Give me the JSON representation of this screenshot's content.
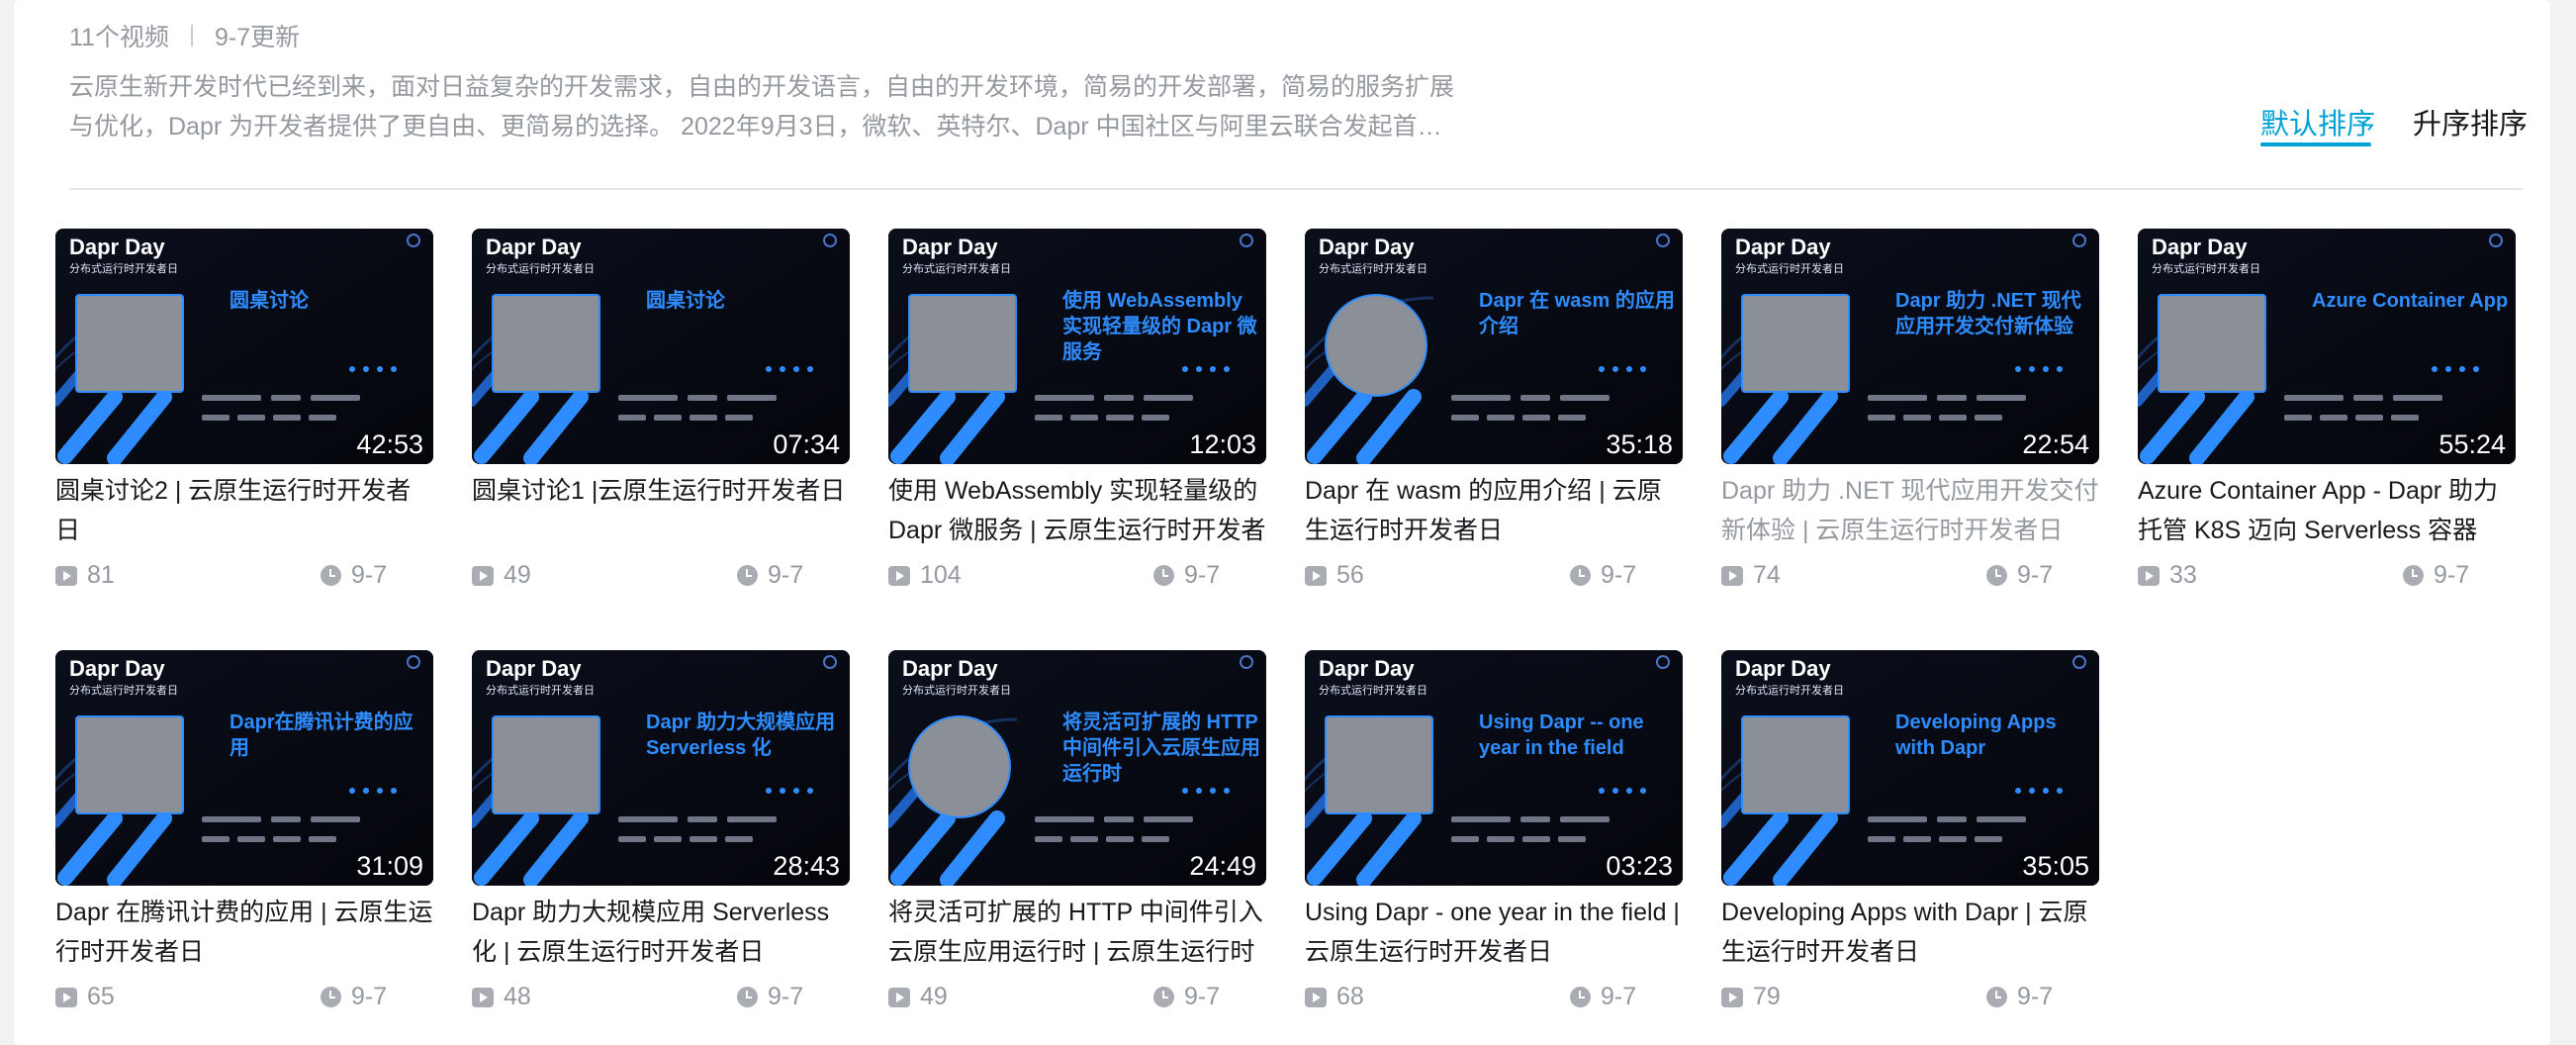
{
  "header": {
    "video_count": "11个视频",
    "updated": "9-7更新",
    "description": "云原生新开发时代已经到来，面对日益复杂的开发需求，自由的开发语言，自由的开发环境，简易的开发部署，简易的服务扩展与优化，Dapr 为开发者提供了更自由、更简易的选择。 2022年9月3日，微软、英特尔、Dapr 中国社区与阿里云联合发起首届 Dap…"
  },
  "sort": {
    "default_label": "默认排序",
    "asc_label": "升序排序"
  },
  "thumb_common": {
    "brand": "Dapr Day",
    "brand_sub": "分布式运行时开发者日"
  },
  "videos": [
    {
      "thumb_title": "圆桌讨论",
      "duration": "42:53",
      "title": "圆桌讨论2 | 云原生运行时开发者日",
      "plays": "81",
      "date": "9-7",
      "visited": false
    },
    {
      "thumb_title": "圆桌讨论",
      "duration": "07:34",
      "title": "圆桌讨论1 |云原生运行时开发者日",
      "plays": "49",
      "date": "9-7",
      "visited": false
    },
    {
      "thumb_title": "使用 WebAssembly 实现轻量级的 Dapr 微服务",
      "duration": "12:03",
      "title": "使用 WebAssembly 实现轻量级的 Dapr 微服务 | 云原生运行时开发者",
      "plays": "104",
      "date": "9-7",
      "visited": false
    },
    {
      "thumb_title": "Dapr 在 wasm 的应用介绍",
      "duration": "35:18",
      "title": "Dapr 在 wasm 的应用介绍 | 云原生运行时开发者日",
      "plays": "56",
      "date": "9-7",
      "visited": false
    },
    {
      "thumb_title": "Dapr 助力 .NET 现代应用开发交付新体验",
      "duration": "22:54",
      "title": "Dapr 助力 .NET 现代应用开发交付新体验 | 云原生运行时开发者日",
      "plays": "74",
      "date": "9-7",
      "visited": true
    },
    {
      "thumb_title": "Azure Container App",
      "duration": "55:24",
      "title": "Azure Container App - Dapr 助力托管 K8S 迈向 Serverless 容器",
      "plays": "33",
      "date": "9-7",
      "visited": false
    },
    {
      "thumb_title": "Dapr在腾讯计费的应用",
      "duration": "31:09",
      "title": "Dapr 在腾讯计费的应用 | 云原生运行时开发者日",
      "plays": "65",
      "date": "9-7",
      "visited": false
    },
    {
      "thumb_title": "Dapr 助力大规模应用 Serverless 化",
      "duration": "28:43",
      "title": "Dapr 助力大规模应用 Serverless 化 | 云原生运行时开发者日",
      "plays": "48",
      "date": "9-7",
      "visited": false
    },
    {
      "thumb_title": "将灵活可扩展的 HTTP 中间件引入云原生应用运行时",
      "duration": "24:49",
      "title": "将灵活可扩展的 HTTP 中间件引入云原生应用运行时 | 云原生运行时",
      "plays": "49",
      "date": "9-7",
      "visited": false
    },
    {
      "thumb_title": "Using Dapr -- one year in the field",
      "duration": "03:23",
      "title": "Using Dapr  -  one year in the field | 云原生运行时开发者日",
      "plays": "68",
      "date": "9-7",
      "visited": false
    },
    {
      "thumb_title": "Developing Apps with Dapr",
      "duration": "35:05",
      "title": "Developing Apps with Dapr | 云原生运行时开发者日",
      "plays": "79",
      "date": "9-7",
      "visited": false
    }
  ]
}
